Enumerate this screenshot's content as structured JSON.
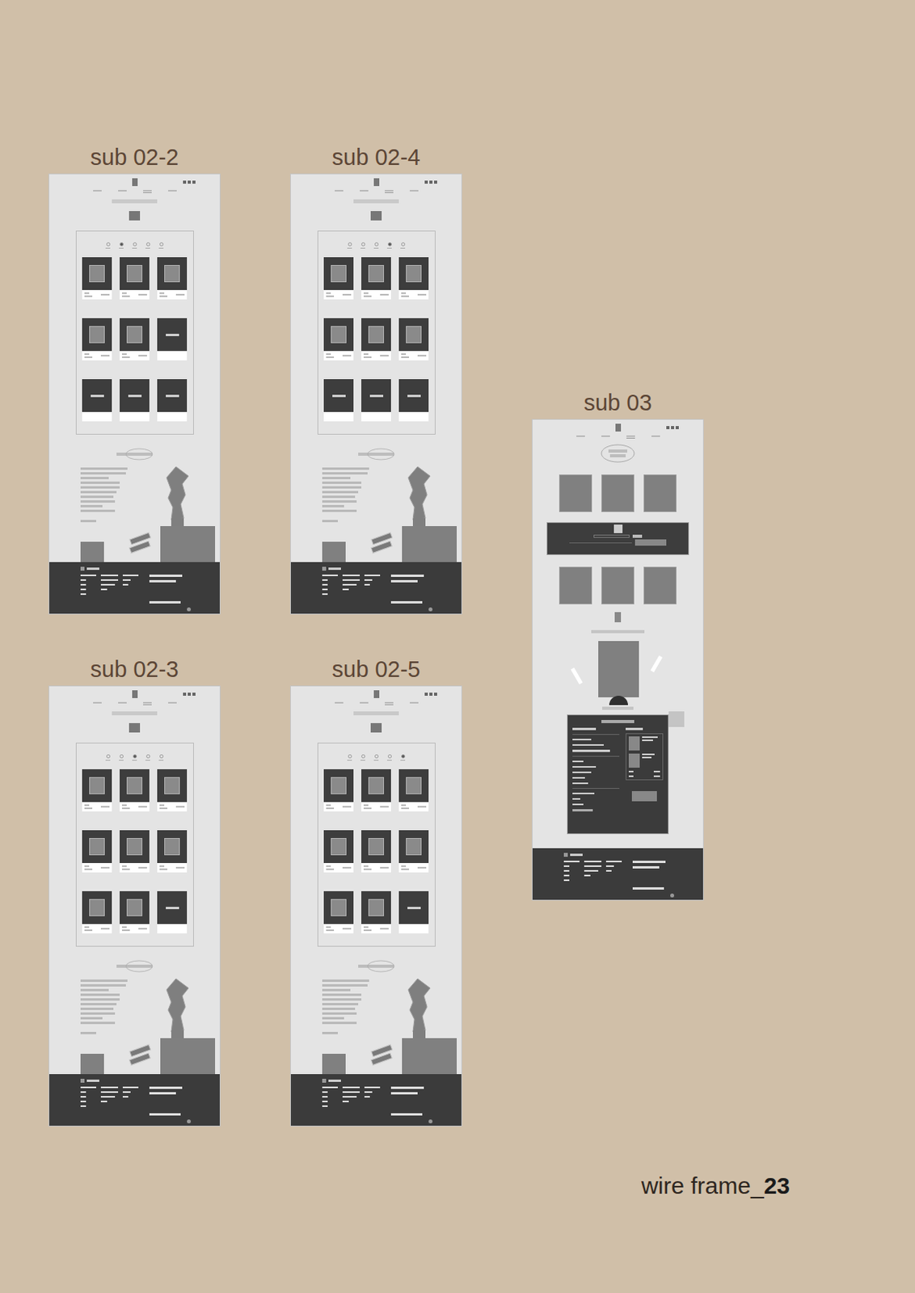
{
  "columns": [
    {
      "frames": [
        {
          "label": "sub 02-2",
          "pagination": [
            {
              "selected": false
            },
            {
              "selected": true
            },
            {
              "selected": false
            },
            {
              "selected": false
            },
            {
              "selected": false
            }
          ],
          "cards": [
            {
              "kind": "image"
            },
            {
              "kind": "image"
            },
            {
              "kind": "image"
            },
            {
              "kind": "image"
            },
            {
              "kind": "image"
            },
            {
              "kind": "empty"
            },
            {
              "kind": "empty"
            },
            {
              "kind": "empty"
            },
            {
              "kind": "empty"
            }
          ]
        },
        {
          "label": "sub 02-3",
          "pagination": [
            {
              "selected": false
            },
            {
              "selected": false
            },
            {
              "selected": true
            },
            {
              "selected": false
            },
            {
              "selected": false
            }
          ],
          "cards": [
            {
              "kind": "image"
            },
            {
              "kind": "image"
            },
            {
              "kind": "image"
            },
            {
              "kind": "image"
            },
            {
              "kind": "image"
            },
            {
              "kind": "image"
            },
            {
              "kind": "image"
            },
            {
              "kind": "image"
            },
            {
              "kind": "empty"
            }
          ]
        }
      ]
    },
    {
      "frames": [
        {
          "label": "sub 02-4",
          "pagination": [
            {
              "selected": false
            },
            {
              "selected": false
            },
            {
              "selected": false
            },
            {
              "selected": true
            },
            {
              "selected": false
            }
          ],
          "cards": [
            {
              "kind": "image"
            },
            {
              "kind": "image"
            },
            {
              "kind": "image"
            },
            {
              "kind": "image"
            },
            {
              "kind": "image"
            },
            {
              "kind": "image"
            },
            {
              "kind": "empty"
            },
            {
              "kind": "empty"
            },
            {
              "kind": "empty"
            }
          ]
        },
        {
          "label": "sub 02-5",
          "pagination": [
            {
              "selected": false
            },
            {
              "selected": false
            },
            {
              "selected": false
            },
            {
              "selected": false
            },
            {
              "selected": true
            }
          ],
          "cards": [
            {
              "kind": "image"
            },
            {
              "kind": "image"
            },
            {
              "kind": "image"
            },
            {
              "kind": "image"
            },
            {
              "kind": "image"
            },
            {
              "kind": "image"
            },
            {
              "kind": "image"
            },
            {
              "kind": "image"
            },
            {
              "kind": "empty"
            }
          ]
        }
      ]
    }
  ],
  "sub03": {
    "label": "sub 03"
  },
  "caption": {
    "text": "wire frame_",
    "number": "23"
  }
}
